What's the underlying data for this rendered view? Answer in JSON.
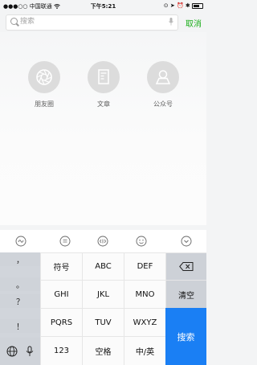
{
  "status_bar": {
    "carrier": "●●●○○ 中国联通",
    "time": "下午5:21",
    "signal_icon": "wifi-icon",
    "right_icons": [
      "lock-icon",
      "location-icon",
      "alarm-icon",
      "bluetooth-icon",
      "battery-icon"
    ]
  },
  "search": {
    "placeholder": "搜索",
    "value": "",
    "cancel_label": "取消"
  },
  "categories": [
    {
      "label": "朋友圈",
      "icon": "moments-aperture-icon"
    },
    {
      "label": "文章",
      "icon": "article-icon"
    },
    {
      "label": "公众号",
      "icon": "official-account-icon"
    }
  ],
  "keyboard": {
    "suggest_icons": [
      "handwriting-icon",
      "chat-icon",
      "cursor-move-icon",
      "emoji-icon",
      "collapse-keyboard-icon"
    ],
    "punctuation": [
      "，",
      "。",
      "？",
      "！"
    ],
    "rows": [
      [
        "符号",
        "ABC",
        "DEF"
      ],
      [
        "GHI",
        "JKL",
        "MNO"
      ],
      [
        "PQRS",
        "TUV",
        "WXYZ"
      ],
      [
        "123",
        "空格",
        "中/英"
      ]
    ],
    "delete_icon": "backspace-icon",
    "clear_label": "清空",
    "search_label": "搜索",
    "bottom_left_icons": [
      "globe-icon",
      "mic-icon"
    ]
  }
}
